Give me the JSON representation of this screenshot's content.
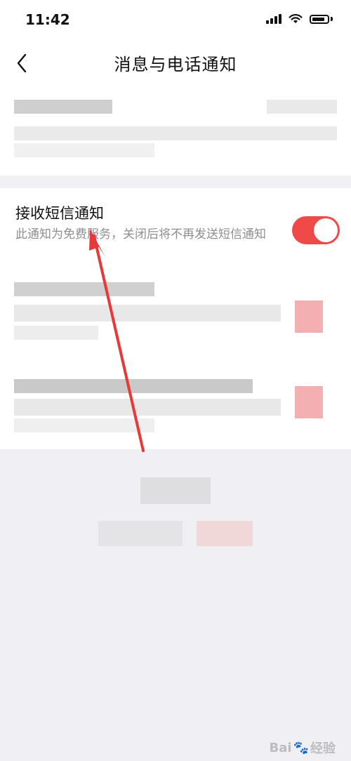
{
  "status_bar": {
    "time": "11:42"
  },
  "nav": {
    "title": "消息与电话通知"
  },
  "sms_setting": {
    "title": "接收短信通知",
    "description": "此通知为免费服务，关闭后将不再发送短信通知",
    "enabled": true
  },
  "watermark": {
    "text_left": "Bai",
    "text_right": "经验"
  },
  "colors": {
    "accent": "#f04a48",
    "arrow": "#e8383a",
    "background": "#efeff4"
  }
}
